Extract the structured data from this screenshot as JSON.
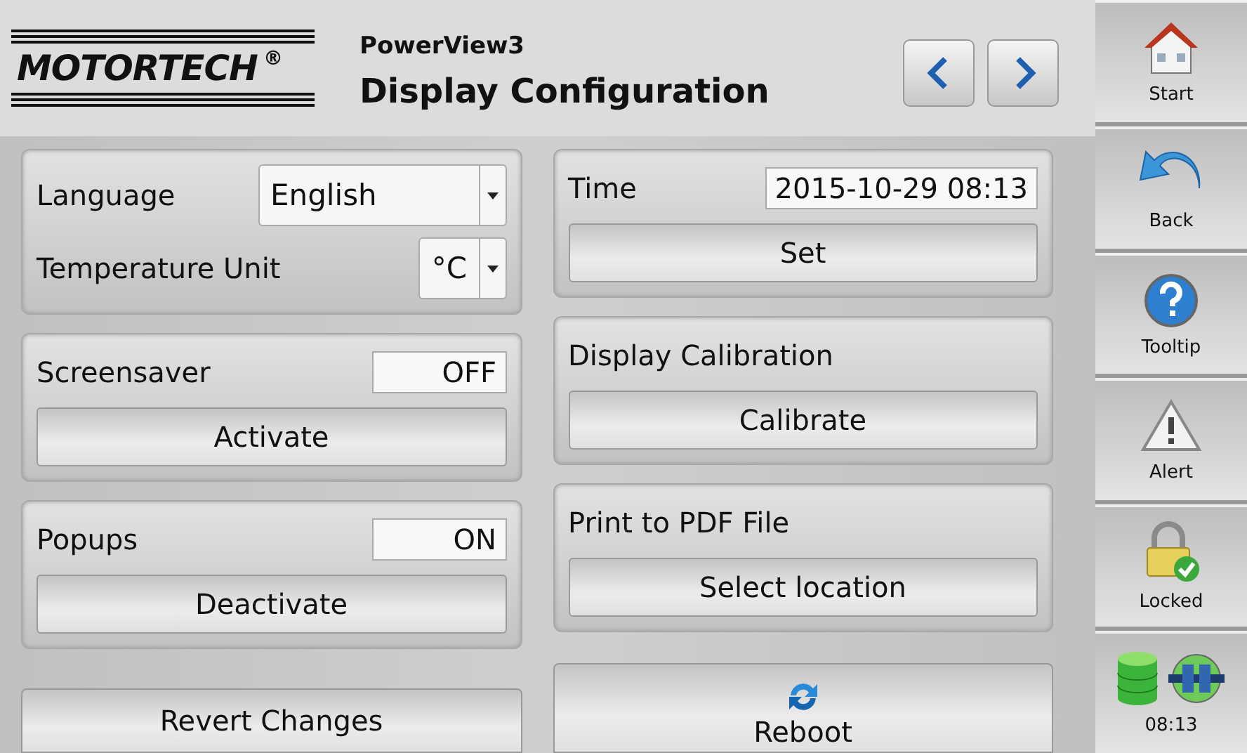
{
  "header": {
    "logo": "MOTORTECH",
    "logo_mark": "®",
    "product": "PowerView3",
    "title": "Display Configuration"
  },
  "left": {
    "language": {
      "label": "Language",
      "value": "English"
    },
    "temperature_unit": {
      "label": "Temperature Unit",
      "value": "°C"
    },
    "toggles": [
      {
        "label": "Screensaver",
        "state": "OFF",
        "button": "Activate"
      },
      {
        "label": "Popups",
        "state": "ON",
        "button": "Deactivate"
      }
    ],
    "revert_button": "Revert Changes"
  },
  "right": {
    "time": {
      "label": "Time",
      "value": "2015-10-29 08:13",
      "button": "Set"
    },
    "actions": [
      {
        "label": "Display Calibration",
        "button": "Calibrate"
      },
      {
        "label": "Print to PDF File",
        "button": "Select location"
      }
    ],
    "reboot_button": "Reboot"
  },
  "sidebar": {
    "items": [
      {
        "kind": "start",
        "label": "Start"
      },
      {
        "kind": "back",
        "label": "Back"
      },
      {
        "kind": "tooltip",
        "label": "Tooltip"
      },
      {
        "kind": "alert",
        "label": "Alert"
      },
      {
        "kind": "locked",
        "label": "Locked"
      },
      {
        "kind": "status",
        "label": "08:13"
      }
    ]
  }
}
